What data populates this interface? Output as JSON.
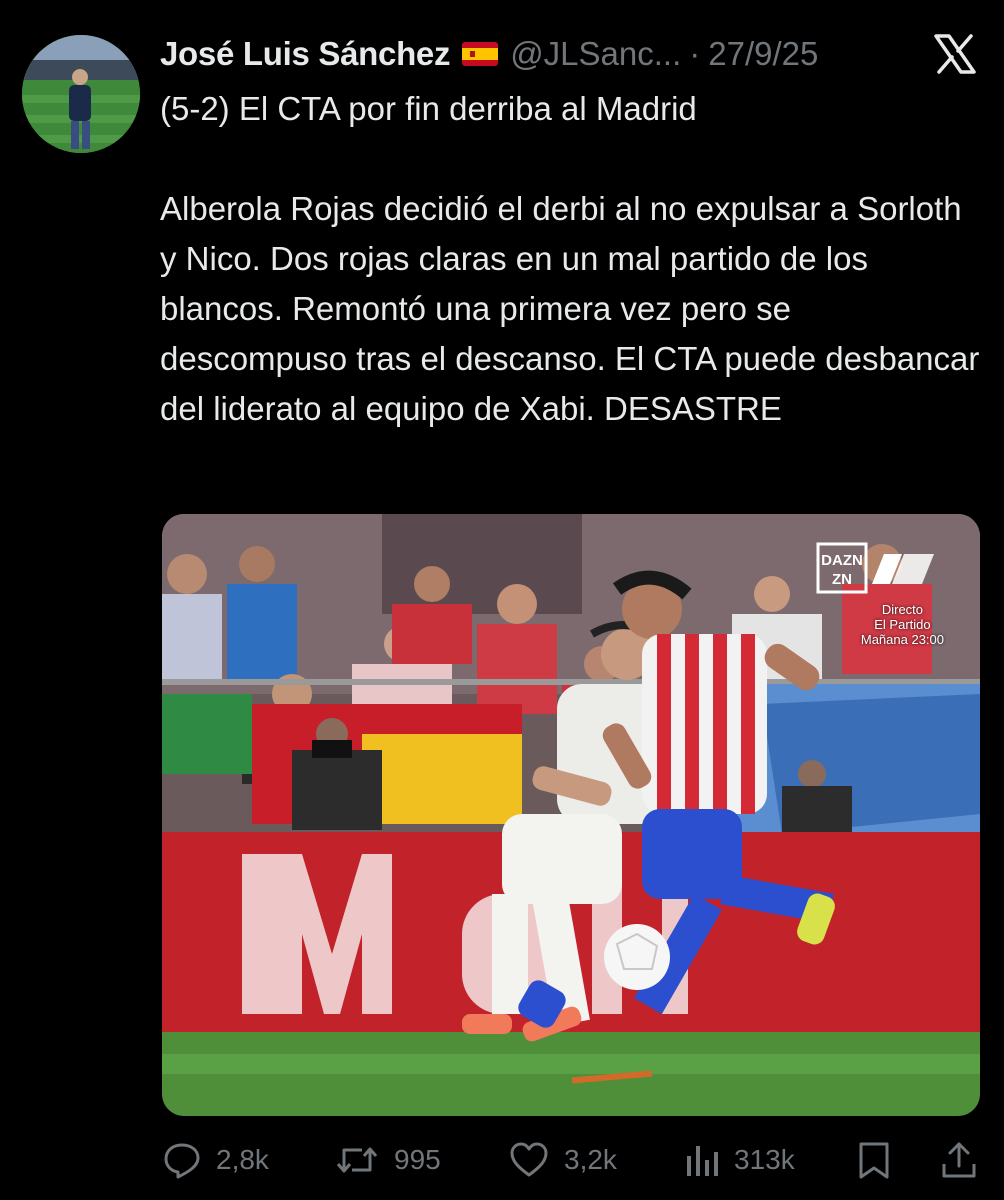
{
  "tweet": {
    "author": {
      "display_name": "José Luis Sánchez",
      "flag_icon": "spain-flag-icon",
      "handle": "@JLSanc...",
      "separator": "·",
      "date": "27/9/25"
    },
    "platform_icon": "x-logo-icon",
    "text_paragraphs": [
      "(5-2) El CTA por fin derriba al Madrid",
      "Alberola Rojas decidió el derbi al no expulsar a Sorloth y Nico. Dos rojas claras en un mal partido de los blancos. Remontó una primera vez pero se descompuso tras el descanso. El CTA puede desbancar del liderato al equipo de Xabi. DESASTRE"
    ],
    "media": {
      "broadcast_logo": "DAZN",
      "broadcast_line1": "Directo",
      "broadcast_line2": "El Partido",
      "broadcast_line3": "Mañana 23:00"
    },
    "actions": {
      "replies": {
        "icon": "reply-icon",
        "count": "2,8k"
      },
      "reposts": {
        "icon": "repost-icon",
        "count": "995"
      },
      "likes": {
        "icon": "heart-icon",
        "count": "3,2k"
      },
      "views": {
        "icon": "views-icon",
        "count": "313k"
      },
      "bookmark": {
        "icon": "bookmark-icon"
      },
      "share": {
        "icon": "share-icon"
      }
    }
  },
  "colors": {
    "background": "#000000",
    "text_primary": "#e7e9ea",
    "text_secondary": "#71767b"
  }
}
